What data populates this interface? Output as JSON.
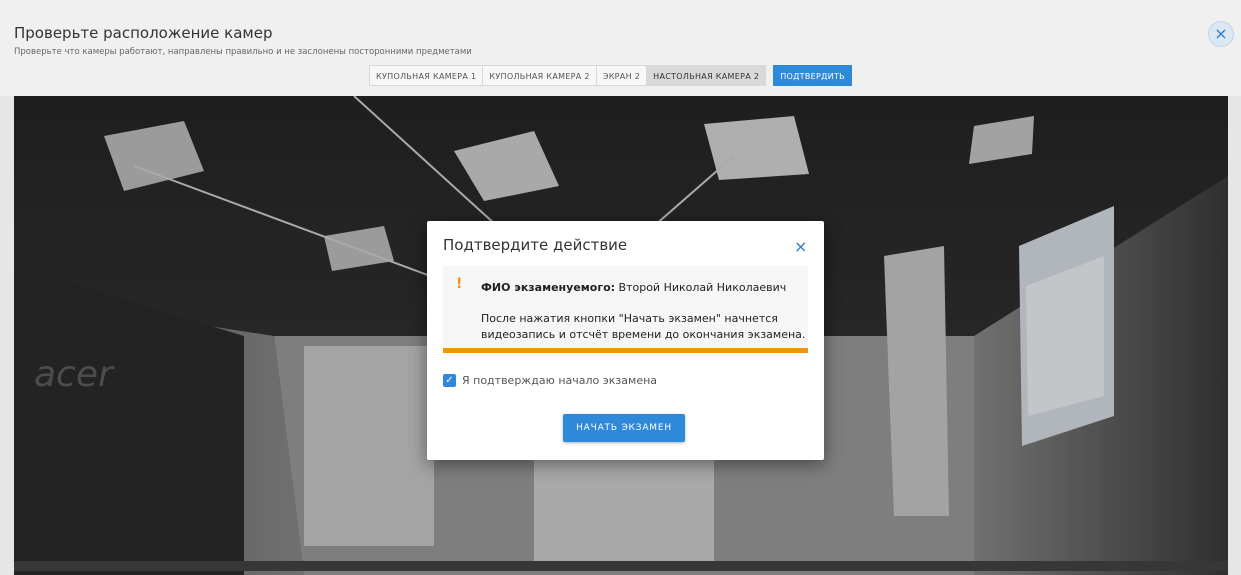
{
  "header": {
    "title": "Проверьте расположение камер",
    "subtitle": "Проверьте что камеры работают, направлены правильно и не заслонены посторонними предметами",
    "close_glyph": "×"
  },
  "tabs": [
    {
      "label": "КУПОЛЬНАЯ КАМЕРА 1",
      "active": false
    },
    {
      "label": "КУПОЛЬНАЯ КАМЕРА 2",
      "active": false
    },
    {
      "label": "ЭКРАН 2",
      "active": false
    },
    {
      "label": "НАСТОЛЬНАЯ КАМЕРА 2",
      "active": true
    }
  ],
  "confirm_button": "ПОДТВЕРДИТЬ",
  "camera_feed": {
    "logo_text": "acer"
  },
  "dialog": {
    "title": "Подтвердите действие",
    "close_glyph": "×",
    "alert": {
      "icon": "!",
      "fio_label": "ФИО экзаменуемого:",
      "fio_value": "Второй Николай Николаевич",
      "text": "После нажатия кнопки \"Начать экзамен\" начнется видеозапись и отсчёт времени до окончания экзамена."
    },
    "checkbox": {
      "checked": true,
      "label": "Я подтверждаю начало экзамена"
    },
    "start_button": "НАЧАТЬ ЭКЗАМЕН"
  },
  "colors": {
    "accent": "#2f89db",
    "warning": "#f0960e"
  }
}
